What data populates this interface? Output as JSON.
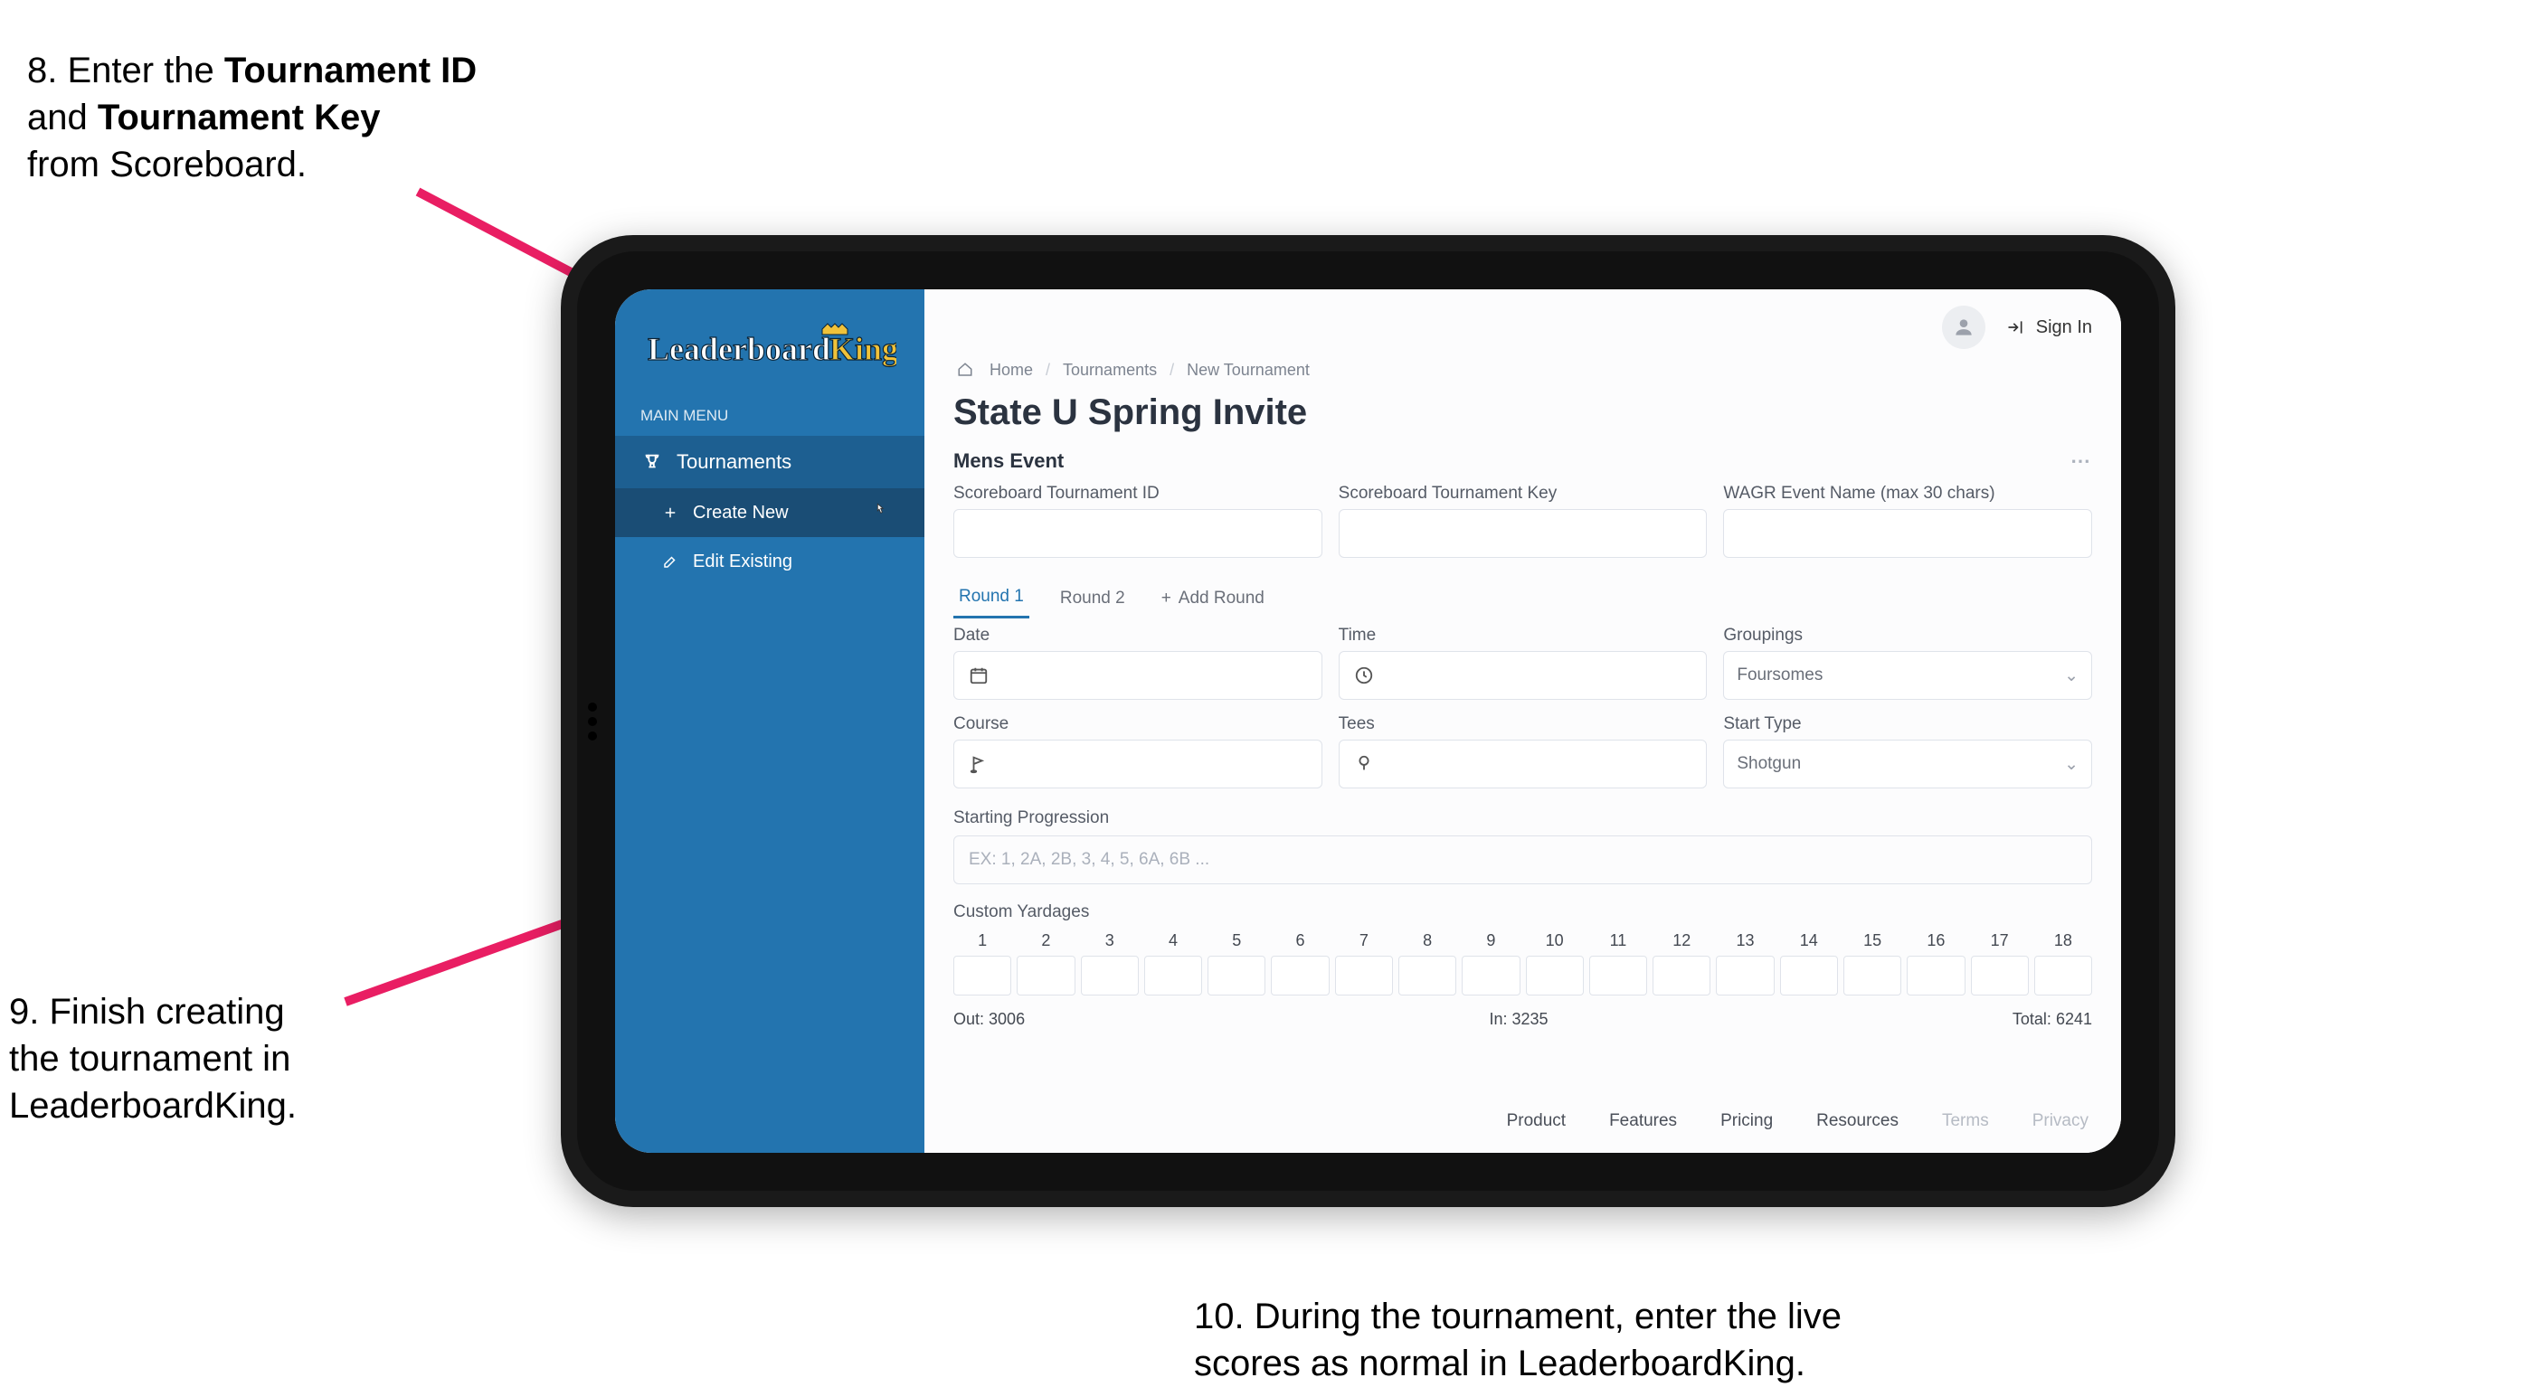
{
  "annotations": {
    "step8_pre": "8. Enter the ",
    "step8_b1": "Tournament ID",
    "step8_mid": "and ",
    "step8_b2": "Tournament Key",
    "step8_post": "from Scoreboard.",
    "step9_l1": "9. Finish creating",
    "step9_l2": "the tournament in",
    "step9_l3": "LeaderboardKing.",
    "step10_l1": "10. During the tournament, enter the live",
    "step10_l2": "scores as normal in LeaderboardKing."
  },
  "sidebar": {
    "menu_label": "MAIN MENU",
    "item_tournaments": "Tournaments",
    "sub_create": "Create New",
    "sub_edit": "Edit Existing"
  },
  "header": {
    "sign_in": "Sign In"
  },
  "breadcrumb": {
    "home": "Home",
    "tournaments": "Tournaments",
    "new": "New Tournament"
  },
  "page": {
    "title": "State U Spring Invite",
    "section": "Mens Event"
  },
  "fields": {
    "sb_id_label": "Scoreboard Tournament ID",
    "sb_key_label": "Scoreboard Tournament Key",
    "wagr_label": "WAGR Event Name (max 30 chars)",
    "date_label": "Date",
    "time_label": "Time",
    "groupings_label": "Groupings",
    "groupings_value": "Foursomes",
    "course_label": "Course",
    "tees_label": "Tees",
    "start_type_label": "Start Type",
    "start_type_value": "Shotgun",
    "starting_label": "Starting Progression",
    "starting_placeholder": "EX: 1, 2A, 2B, 3, 4, 5, 6A, 6B ...",
    "custom_yardages": "Custom Yardages"
  },
  "tabs": {
    "r1": "Round 1",
    "r2": "Round 2",
    "add": "Add Round"
  },
  "yardage": {
    "holes": [
      "1",
      "2",
      "3",
      "4",
      "5",
      "6",
      "7",
      "8",
      "9",
      "10",
      "11",
      "12",
      "13",
      "14",
      "15",
      "16",
      "17",
      "18"
    ],
    "out_label": "Out:",
    "out_val": "3006",
    "in_label": "In:",
    "in_val": "3235",
    "total_label": "Total:",
    "total_val": "6241"
  },
  "footer": {
    "product": "Product",
    "features": "Features",
    "pricing": "Pricing",
    "resources": "Resources",
    "terms": "Terms",
    "privacy": "Privacy"
  }
}
